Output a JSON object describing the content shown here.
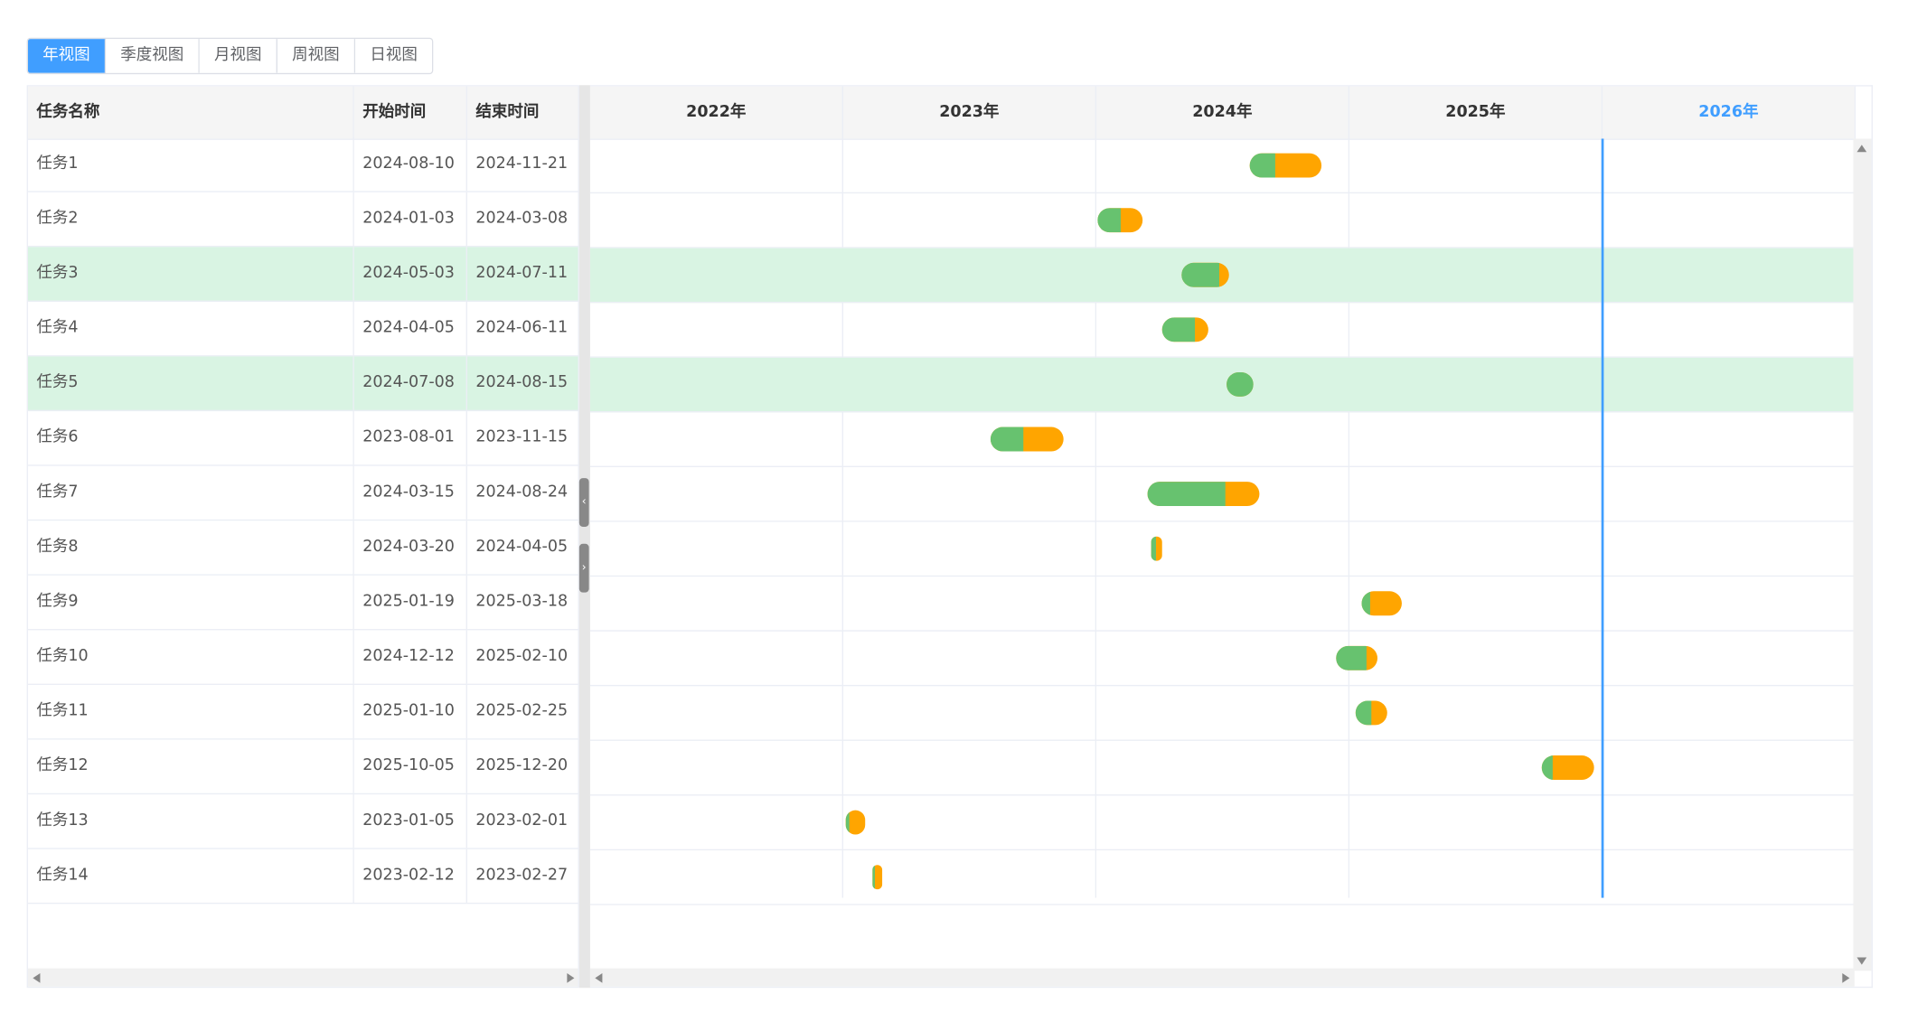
{
  "view_tabs": [
    {
      "label": "年视图",
      "active": true
    },
    {
      "label": "季度视图",
      "active": false
    },
    {
      "label": "月视图",
      "active": false
    },
    {
      "label": "周视图",
      "active": false
    },
    {
      "label": "日视图",
      "active": false
    }
  ],
  "columns": {
    "name": "任务名称",
    "start": "开始时间",
    "end": "结束时间"
  },
  "years": [
    "2022年",
    "2023年",
    "2024年",
    "2025年",
    "2026年"
  ],
  "current_year": "2026年",
  "today_marker": "2026-01-01",
  "colors": {
    "progress_done": "#67c26f",
    "progress_remaining": "#ffa500",
    "row_highlight": "#d9f4e3",
    "accent": "#409eff"
  },
  "tasks": [
    {
      "name": "任务1",
      "start": "2024-08-10",
      "end": "2024-11-21",
      "progress": 0.35,
      "highlighted": false
    },
    {
      "name": "任务2",
      "start": "2024-01-03",
      "end": "2024-03-08",
      "progress": 0.5,
      "highlighted": false
    },
    {
      "name": "任务3",
      "start": "2024-05-03",
      "end": "2024-07-11",
      "progress": 0.8,
      "highlighted": true
    },
    {
      "name": "任务4",
      "start": "2024-04-05",
      "end": "2024-06-11",
      "progress": 0.7,
      "highlighted": false
    },
    {
      "name": "任务5",
      "start": "2024-07-08",
      "end": "2024-08-15",
      "progress": 1.0,
      "highlighted": true
    },
    {
      "name": "任务6",
      "start": "2023-08-01",
      "end": "2023-11-15",
      "progress": 0.45,
      "highlighted": false
    },
    {
      "name": "任务7",
      "start": "2024-03-15",
      "end": "2024-08-24",
      "progress": 0.7,
      "highlighted": false
    },
    {
      "name": "任务8",
      "start": "2024-03-20",
      "end": "2024-04-05",
      "progress": 0.5,
      "highlighted": false
    },
    {
      "name": "任务9",
      "start": "2025-01-19",
      "end": "2025-03-18",
      "progress": 0.2,
      "highlighted": false
    },
    {
      "name": "任务10",
      "start": "2024-12-12",
      "end": "2025-02-10",
      "progress": 0.75,
      "highlighted": false
    },
    {
      "name": "任务11",
      "start": "2025-01-10",
      "end": "2025-02-25",
      "progress": 0.5,
      "highlighted": false
    },
    {
      "name": "任务12",
      "start": "2025-10-05",
      "end": "2025-12-20",
      "progress": 0.2,
      "highlighted": false
    },
    {
      "name": "任务13",
      "start": "2023-01-05",
      "end": "2023-02-01",
      "progress": 0.2,
      "highlighted": false
    },
    {
      "name": "任务14",
      "start": "2023-02-12",
      "end": "2023-02-27",
      "progress": 0.3,
      "highlighted": false
    }
  ]
}
